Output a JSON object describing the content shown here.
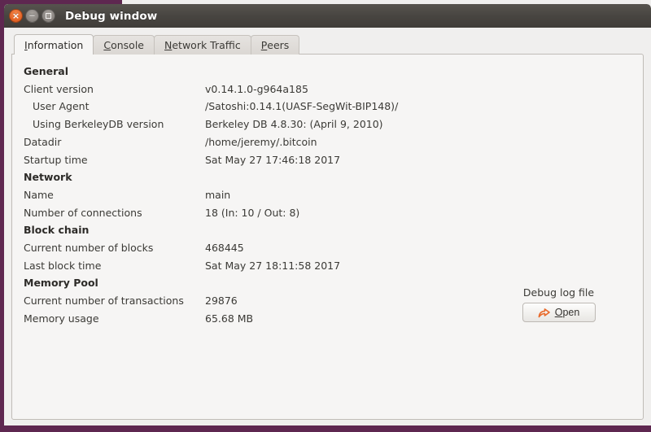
{
  "window": {
    "title": "Debug window",
    "controls": [
      {
        "name": "close-button",
        "glyph": "×"
      },
      {
        "name": "minimize-button",
        "glyph": "−"
      },
      {
        "name": "maximize-button",
        "glyph": ""
      }
    ]
  },
  "tabs": [
    {
      "label": "Information",
      "mnemonic": "I",
      "rest": "nformation",
      "active": true
    },
    {
      "label": "Console",
      "mnemonic": "C",
      "rest": "onsole",
      "active": false
    },
    {
      "label": "Network Traffic",
      "mnemonic": "N",
      "rest": "etwork Traffic",
      "active": false
    },
    {
      "label": "Peers",
      "mnemonic": "P",
      "rest": "eers",
      "active": false
    }
  ],
  "sections": [
    {
      "heading": "General",
      "rows": [
        {
          "label": "Client version",
          "value": "v0.14.1.0-g964a185",
          "indent": false
        },
        {
          "label": "User Agent",
          "value": "/Satoshi:0.14.1(UASF-SegWit-BIP148)/",
          "indent": true
        },
        {
          "label": "Using BerkeleyDB version",
          "value": "Berkeley DB 4.8.30: (April  9, 2010)",
          "indent": true
        },
        {
          "label": "Datadir",
          "value": "/home/jeremy/.bitcoin",
          "indent": false
        },
        {
          "label": "Startup time",
          "value": "Sat May 27 17:46:18 2017",
          "indent": false
        }
      ]
    },
    {
      "heading": "Network",
      "rows": [
        {
          "label": "Name",
          "value": "main",
          "indent": false
        },
        {
          "label": "Number of connections",
          "value": "18 (In: 10 / Out: 8)",
          "indent": false
        }
      ]
    },
    {
      "heading": "Block chain",
      "rows": [
        {
          "label": "Current number of blocks",
          "value": "468445",
          "indent": false
        },
        {
          "label": "Last block time",
          "value": "Sat May 27 18:11:58 2017",
          "indent": false
        }
      ]
    },
    {
      "heading": "Memory Pool",
      "rows": [
        {
          "label": "Current number of transactions",
          "value": "29876",
          "indent": false
        },
        {
          "label": "Memory usage",
          "value": "65.68 MB",
          "indent": false
        }
      ]
    }
  ],
  "debug_log": {
    "caption": "Debug log file",
    "open_label": "Open",
    "open_mnemonic": "O",
    "open_rest": "pen",
    "icon": "open-arrow-icon"
  },
  "colors": {
    "desktop": "#5e2750",
    "titlebar": "#474440",
    "window_bg": "#f0efee",
    "panel_bg": "#f6f5f4",
    "text": "#3b3a36",
    "accent_orange": "#e8692a"
  }
}
